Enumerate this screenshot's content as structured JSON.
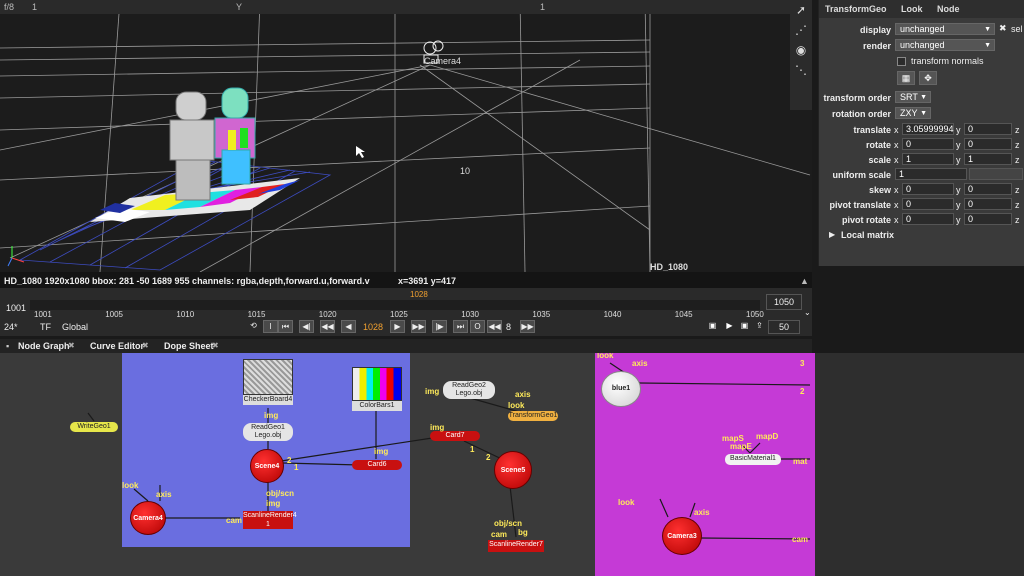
{
  "viewer": {
    "top_left": "f/8",
    "top_frame": "1",
    "top_y": "Y",
    "top_mid": "1",
    "camera_label": "Camera4",
    "grid_label": "10",
    "hd_label": "HD_1080"
  },
  "info_bar": {
    "format": "HD_1080 1920x1080",
    "bbox": "bbox: 281 -50 1689 955 channels: rgba,depth,forward.u,forward.v",
    "coords": "x=3691 y=417"
  },
  "timeline": {
    "start": "1001",
    "end": "1050",
    "current_marker": "1028",
    "ticks": [
      "1001",
      "1005",
      "1010",
      "1015",
      "1020",
      "1025",
      "1030",
      "1035",
      "1040",
      "1045",
      "1050"
    ],
    "fps": "24*",
    "tf": "TF",
    "scope": "Global",
    "current_frame": "1028",
    "step": "8",
    "end_box": "1050",
    "playback_count": "50"
  },
  "panel_tabs": [
    {
      "label": "Node Graph"
    },
    {
      "label": "Curve Editor"
    },
    {
      "label": "Dope Sheet"
    }
  ],
  "properties": {
    "tabs": [
      "TransformGeo",
      "Look",
      "Node"
    ],
    "display_label": "display",
    "display_value": "unchanged",
    "render_label": "render",
    "render_value": "unchanged",
    "sel_label": "sel",
    "transform_normals": "transform normals",
    "transform_order_label": "transform order",
    "transform_order_value": "SRT",
    "rotation_order_label": "rotation order",
    "rotation_order_value": "ZXY",
    "rows": [
      {
        "label": "translate",
        "x": "3.05999994",
        "y": "0"
      },
      {
        "label": "rotate",
        "x": "0",
        "y": "0"
      },
      {
        "label": "scale",
        "x": "1",
        "y": "1"
      },
      {
        "label": "uniform scale",
        "x": "1",
        "y": ""
      },
      {
        "label": "skew",
        "x": "0",
        "y": "0"
      },
      {
        "label": "pivot translate",
        "x": "0",
        "y": "0"
      },
      {
        "label": "pivot rotate",
        "x": "0",
        "y": "0"
      }
    ],
    "local_matrix": "Local matrix",
    "x_axis": "x",
    "y_axis": "y",
    "z_axis": "z"
  },
  "nodes": {
    "write": "WriteGeo1",
    "checker": "CheckerBoard4",
    "colorbars": "ColorBars1",
    "readgeo1": "ReadGeo1\nLego.obj",
    "readgeo1_l1": "ReadGeo1",
    "readgeo1_l2": "Lego.obj",
    "readgeo2_l1": "ReadGeo2",
    "readgeo2_l2": "Lego.obj",
    "transformgeo": "TransformGeo1",
    "scene4": "Scene4",
    "card6": "Card6",
    "card7": "Card7",
    "scene5": "Scene5",
    "camera4": "Camera4",
    "scanline4": "ScanlineRender4",
    "scanline7": "ScanlineRender7",
    "blue1": "blue1",
    "basicmaterial": "BasicMaterial1",
    "camera3": "Camera3"
  },
  "pipes": {
    "img": "img",
    "look": "look",
    "axis": "axis",
    "cam": "cam",
    "objscn": "obj/scn",
    "bg": "bg",
    "mapS": "mapS",
    "mapD": "mapD",
    "mapE": "mapE",
    "mat": "mat",
    "one": "1",
    "two": "2",
    "three": "3"
  },
  "colors": {
    "backdrop_blue": "#6a6ee0",
    "backdrop_magenta": "#c53ad6",
    "node_red": "#d01010",
    "pipe_yellow": "#ffeb5a"
  }
}
